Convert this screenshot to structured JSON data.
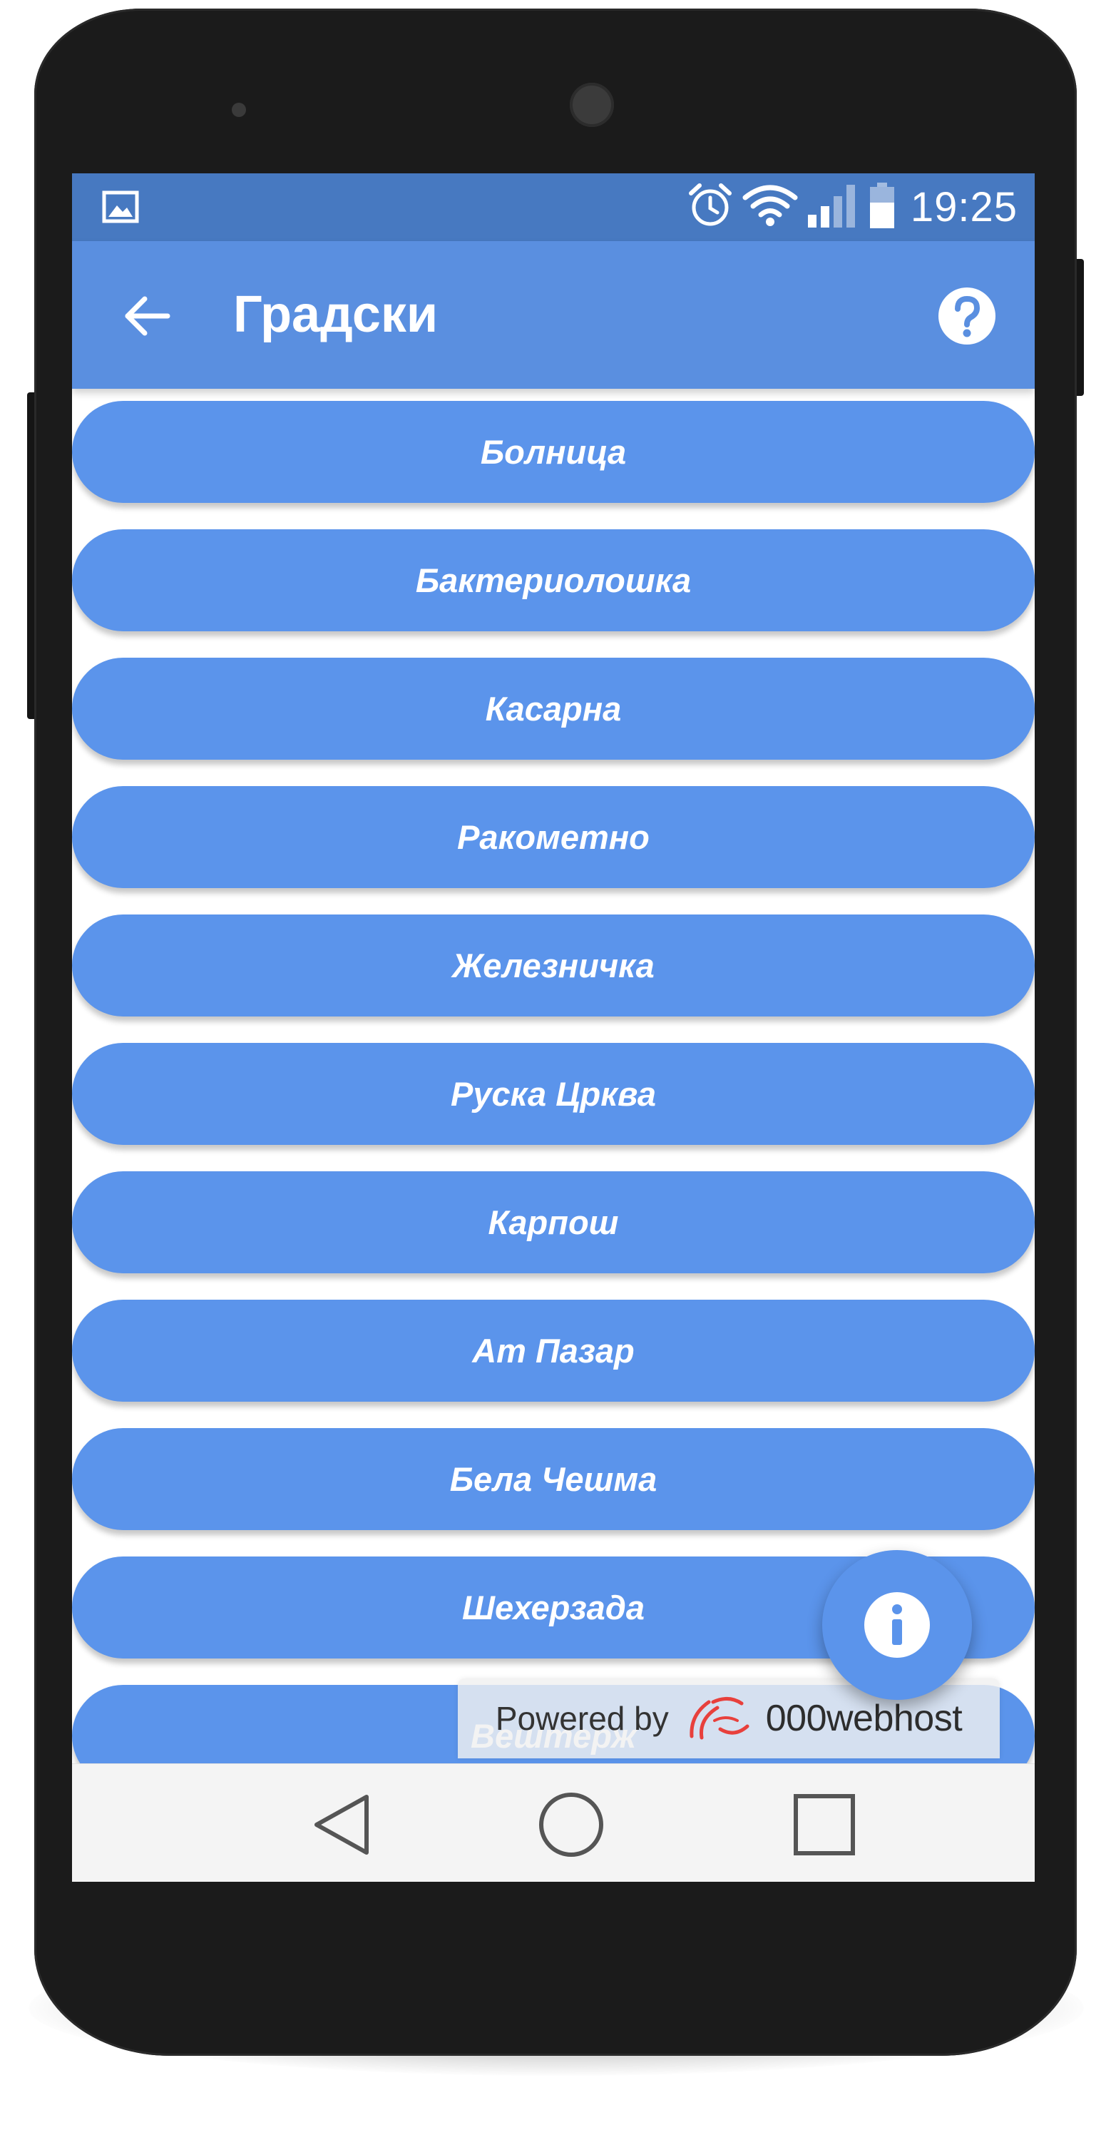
{
  "status_bar": {
    "time": "19:25",
    "icons": [
      "image-icon",
      "alarm-icon",
      "wifi-icon",
      "signal-icon",
      "battery-icon"
    ]
  },
  "app_bar": {
    "title": "Градски",
    "back_icon": "arrow-left-icon",
    "help_icon": "help-circle-icon"
  },
  "stops": [
    {
      "label": "Болница"
    },
    {
      "label": "Бактериолошка"
    },
    {
      "label": "Касарна"
    },
    {
      "label": "Ракометно"
    },
    {
      "label": "Железничка"
    },
    {
      "label": "Руска Црква"
    },
    {
      "label": "Карпош"
    },
    {
      "label": "Ат Пазар"
    },
    {
      "label": "Бела Чешма"
    },
    {
      "label": "Шехерзада"
    },
    {
      "label": "Вештерж"
    }
  ],
  "fab": {
    "icon": "info-icon"
  },
  "watermark": {
    "prefix": "Powered by",
    "brand": "000webhost",
    "logo_icon": "000webhost-swirl-logo"
  },
  "nav_bar": {
    "icons": [
      "back-triangle-icon",
      "home-circle-icon",
      "recents-square-icon"
    ]
  },
  "colors": {
    "status_bar": "#4779c1",
    "app_bar": "#5a8fe0",
    "list_item": "#5b94eb",
    "device": "#1b1b1b"
  }
}
